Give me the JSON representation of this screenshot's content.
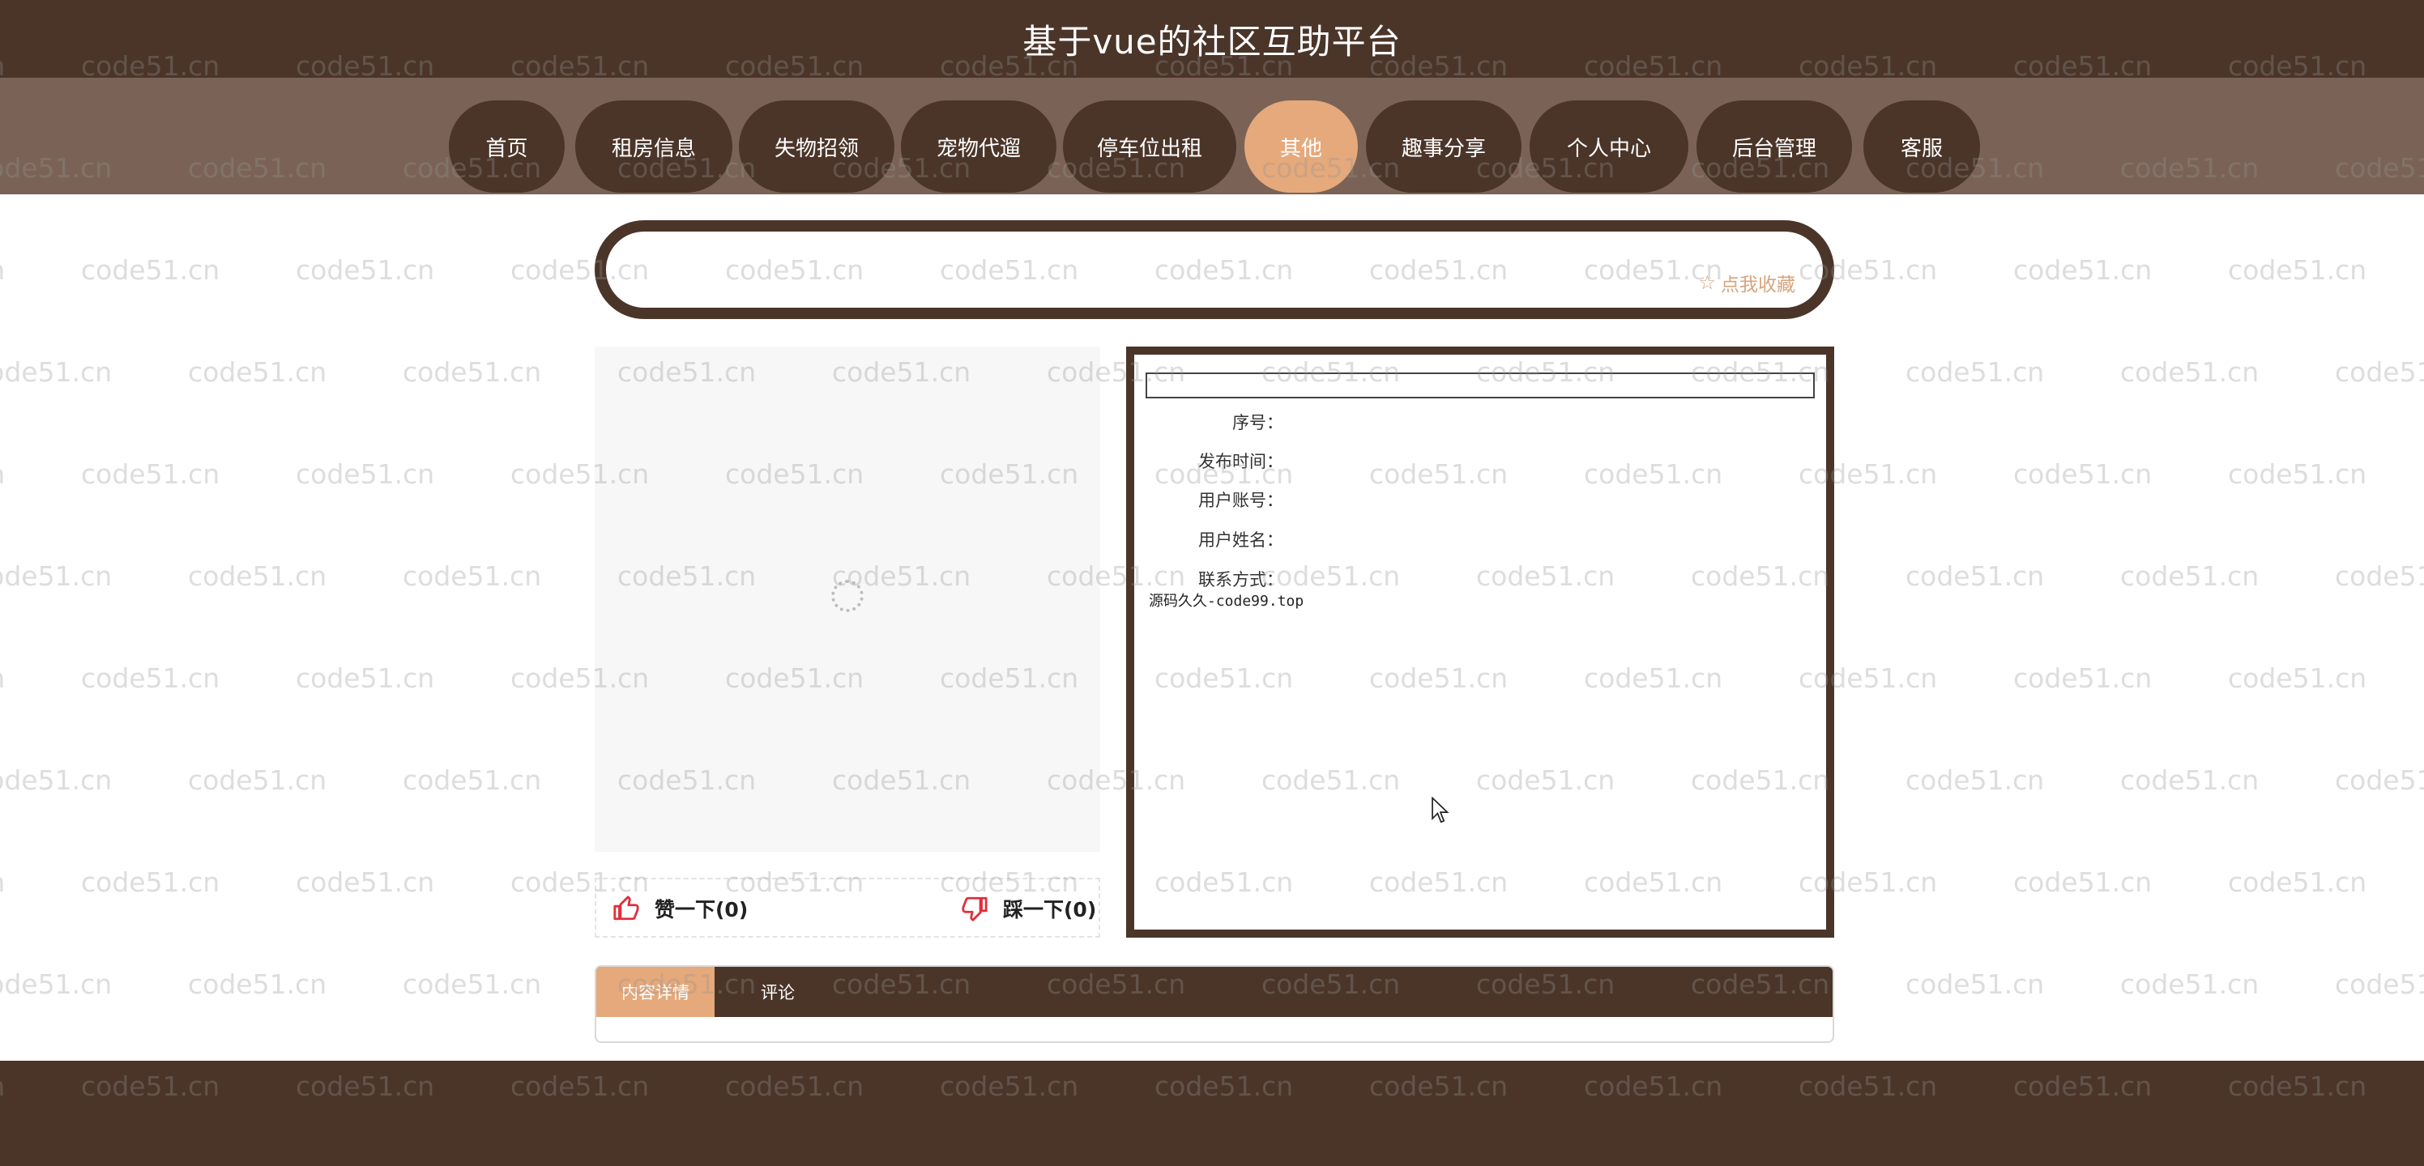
{
  "site": {
    "title": "基于vue的社区互助平台"
  },
  "nav": {
    "items": [
      {
        "label": "首页",
        "active": false
      },
      {
        "label": "租房信息",
        "active": false
      },
      {
        "label": "失物招领",
        "active": false
      },
      {
        "label": "宠物代遛",
        "active": false
      },
      {
        "label": "停车位出租",
        "active": false
      },
      {
        "label": "其他",
        "active": true
      },
      {
        "label": "趣事分享",
        "active": false
      },
      {
        "label": "个人中心",
        "active": false
      },
      {
        "label": "后台管理",
        "active": false
      },
      {
        "label": "客服",
        "active": false
      }
    ]
  },
  "favorite": {
    "icon": "star-icon",
    "label": "点我收藏"
  },
  "votes": {
    "like": {
      "icon": "thumbs-up-icon",
      "label": "赞一下(0)"
    },
    "dislike": {
      "icon": "thumbs-down-icon",
      "label": "踩一下(0)"
    }
  },
  "detail": {
    "fields": [
      {
        "label": "序号："
      },
      {
        "label": "发布时间："
      },
      {
        "label": "用户账号："
      },
      {
        "label": "用户姓名："
      },
      {
        "label": "联系方式："
      }
    ],
    "watermark_text": "源码久久-code99.top"
  },
  "tabs": [
    {
      "label": "内容详情",
      "active": true
    },
    {
      "label": "评论",
      "active": false
    }
  ],
  "watermark": "code51.cn",
  "colors": {
    "primary_brown": "#4b3529",
    "nav_bg": "#7a6356",
    "accent": "#e5a97b",
    "favorite_text": "#d7a47d"
  }
}
